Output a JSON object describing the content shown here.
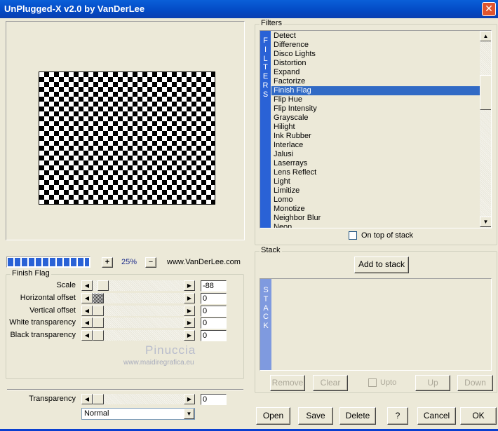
{
  "window": {
    "title": "UnPlugged-X v2.0 by VanDerLee",
    "close_icon": "close-x-icon"
  },
  "preview": {
    "image": "checkerboard",
    "zoom": "25%",
    "zoom_in": "+",
    "zoom_out": "−",
    "url": "www.VanDerLee.com",
    "progress_percent": 100
  },
  "filter_panel": {
    "title": "Finish Flag",
    "sliders": [
      {
        "label": "Scale",
        "value": "-88",
        "fraction": 0.06
      },
      {
        "label": "Horizontal offset",
        "value": "0",
        "fraction": 0.0
      },
      {
        "label": "Vertical offset",
        "value": "0",
        "fraction": 0.0
      },
      {
        "label": "White transparency",
        "value": "0",
        "fraction": 0.0
      },
      {
        "label": "Black transparency",
        "value": "0",
        "fraction": 0.0
      }
    ]
  },
  "watermark": {
    "name": "Pinuccia",
    "url": "www.maidiregrafica.eu"
  },
  "transparency": {
    "label": "Transparency",
    "value": "0",
    "fraction": 0.0,
    "blend_mode": "Normal"
  },
  "filters": {
    "title": "Filters",
    "strip": "FILTERS",
    "selected": "Finish Flag",
    "items": [
      "Detect",
      "Difference",
      "Disco Lights",
      "Distortion",
      "Expand",
      "Factorize",
      "Finish Flag",
      "Flip Hue",
      "Flip Intensity",
      "Grayscale",
      "Hilight",
      "Ink Rubber",
      "Interlace",
      "Jalusi",
      "Laserrays",
      "Lens Reflect",
      "Light",
      "Limitize",
      "Lomo",
      "Monotize",
      "Neighbor Blur",
      "Neon"
    ],
    "on_top_label": "On top of stack",
    "on_top_checked": false
  },
  "stack": {
    "title": "Stack",
    "strip": "STACK",
    "add": "Add to stack",
    "remove": "Remove",
    "clear": "Clear",
    "upto": "Upto",
    "up": "Up",
    "down": "Down"
  },
  "buttons": {
    "open": "Open",
    "save": "Save",
    "delete": "Delete",
    "help": "?",
    "cancel": "Cancel",
    "ok": "OK"
  }
}
